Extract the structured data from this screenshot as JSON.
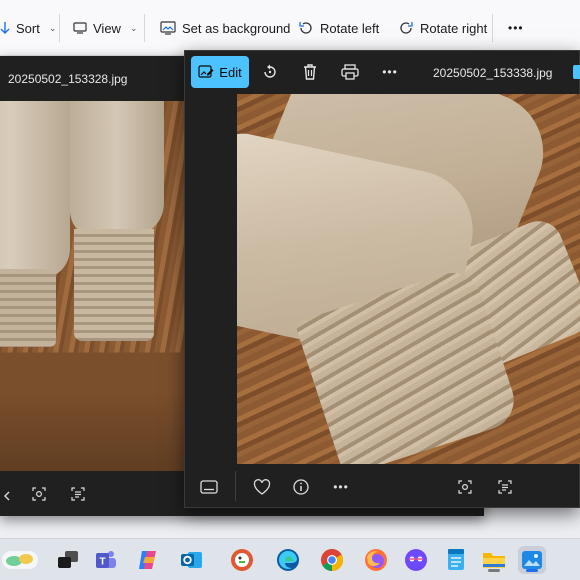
{
  "toolbar": {
    "sort_label": "Sort",
    "view_label": "View",
    "set_background_label": "Set as background",
    "rotate_left_label": "Rotate left",
    "rotate_right_label": "Rotate right",
    "more_label": "•••"
  },
  "viewer_back": {
    "filename": "20250502_153328.jpg"
  },
  "viewer_front": {
    "edit_label": "Edit",
    "filename": "20250502_153338.jpg",
    "more_label": "•••",
    "bottom_more_label": "•••"
  },
  "colors": {
    "accent": "#4cc2ff",
    "viewer_bg": "#202020",
    "toolbar_bg": "#f9f9fb",
    "taskbar_bg": "#dfe3ea"
  },
  "taskbar": {
    "icons": [
      "widgets-icon",
      "task-view-icon",
      "teams-icon",
      "copilot-icon",
      "outlook-icon",
      "duckduckgo-icon",
      "edge-icon",
      "chrome-icon",
      "firefox-icon",
      "proton-icon",
      "notepad-icon",
      "file-explorer-icon",
      "photos-icon"
    ]
  }
}
